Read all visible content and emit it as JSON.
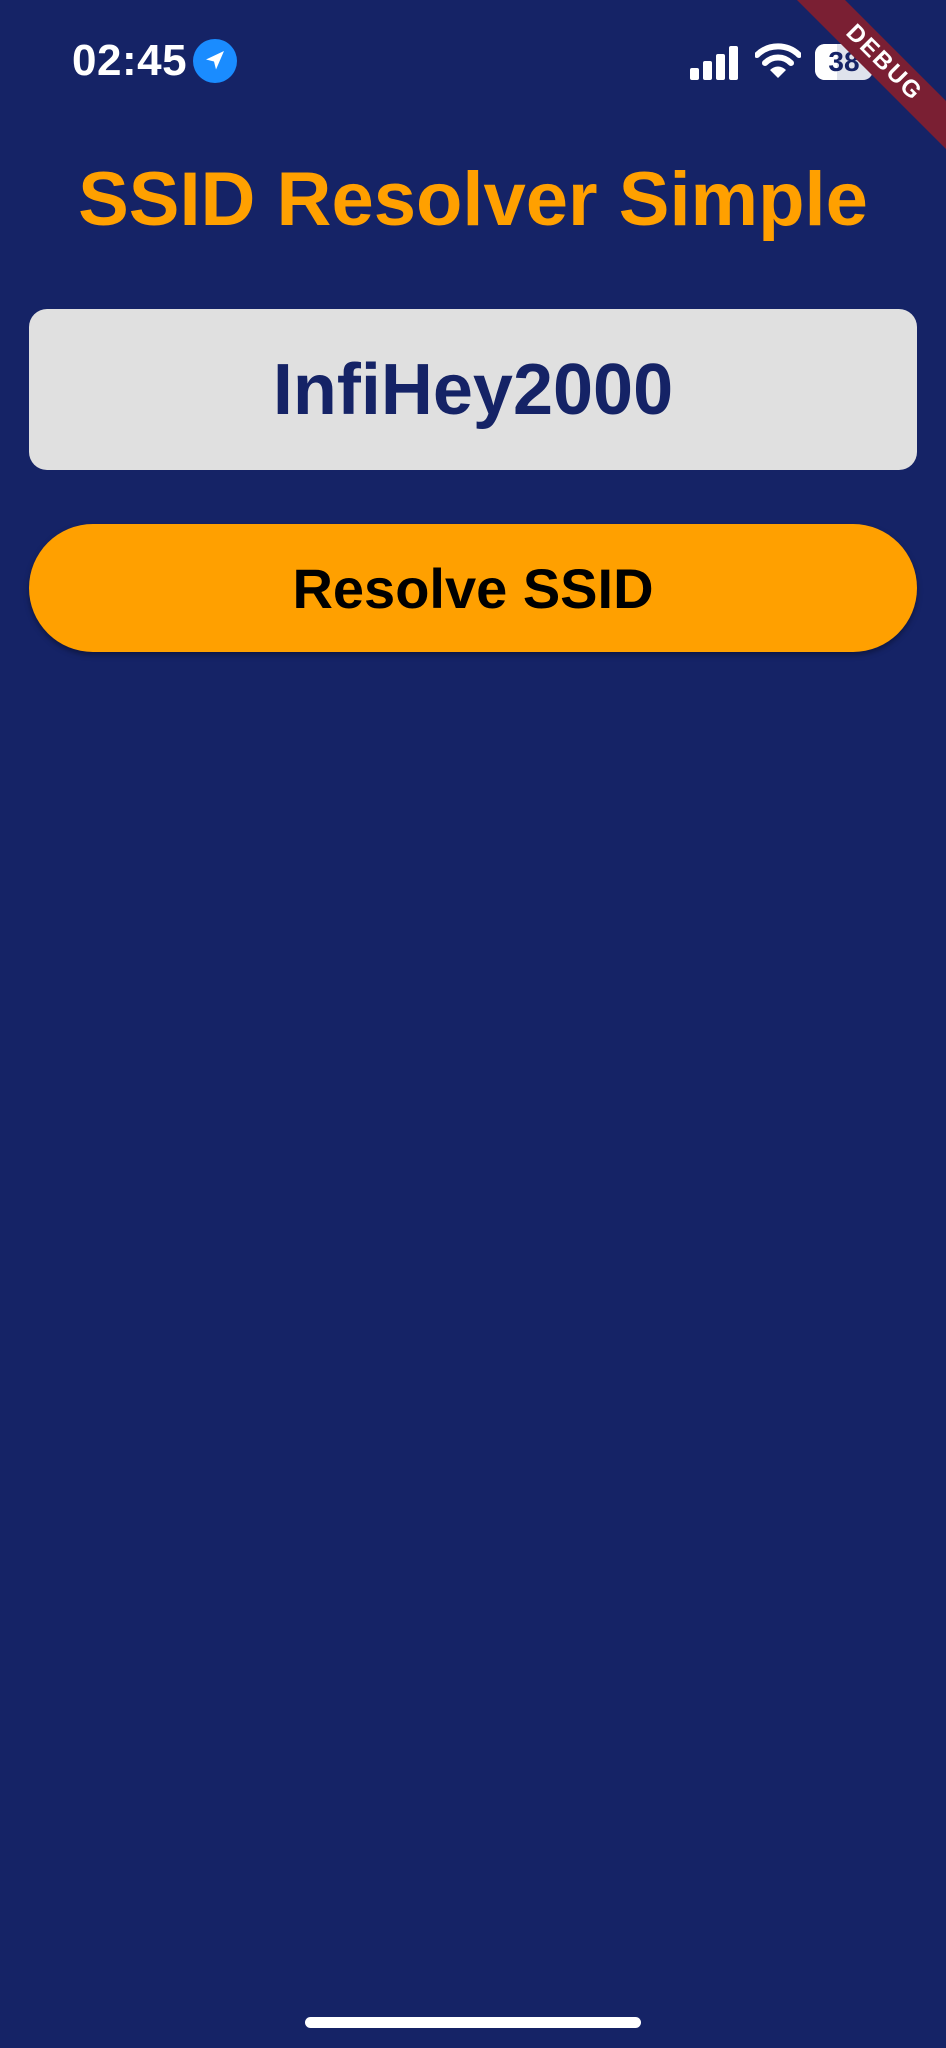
{
  "status_bar": {
    "time": "02:45",
    "battery_level": "38",
    "battery_fraction": 0.38,
    "icons": [
      "location-arrow-icon",
      "cellular-signal-icon",
      "wifi-icon",
      "battery-icon"
    ]
  },
  "debug_banner": {
    "label": "DEBUG"
  },
  "header": {
    "title": "SSID Resolver Simple"
  },
  "ssid_display": {
    "value": "InfiHey2000"
  },
  "actions": {
    "resolve_label": "Resolve SSID"
  },
  "colors": {
    "background": "#152366",
    "accent": "#ffa000",
    "ssid_box": "#e0e0e0",
    "location_icon": "#1a8cff",
    "debug_banner": "#7a1f33"
  }
}
